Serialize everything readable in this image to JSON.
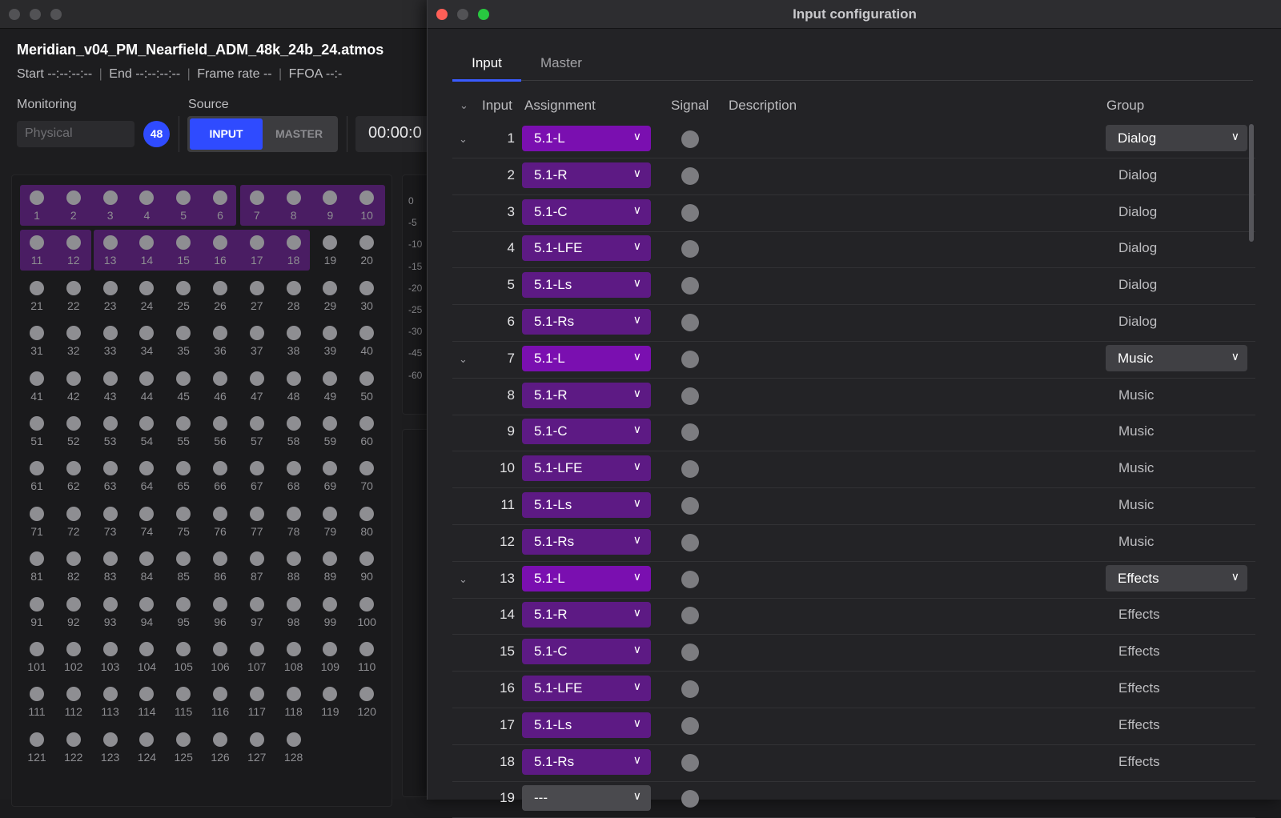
{
  "background_window": {
    "session_name": "Meridian_v04_PM_Nearfield_ADM_48k_24b_24.atmos",
    "start_label": "Start",
    "start_value": "--:--:--:--",
    "end_label": "End",
    "end_value": "--:--:--:--",
    "frame_rate_label": "Frame rate",
    "frame_rate_value": "--",
    "ffoa_label": "FFOA",
    "ffoa_value": "--:-",
    "monitoring_label": "Monitoring",
    "monitoring_value": "Physical",
    "channel_count": "48",
    "source_label": "Source",
    "source_input": "INPUT",
    "source_master": "MASTER",
    "timecode": "00:00:0",
    "meter_scale": [
      "0",
      "-5",
      "-10",
      "-15",
      "-20",
      "-25",
      "-30",
      "-45",
      "-60"
    ],
    "total_channels": 128
  },
  "window": {
    "title": "Input configuration"
  },
  "tabs": [
    {
      "label": "Input",
      "active": true
    },
    {
      "label": "Master",
      "active": false
    }
  ],
  "table": {
    "headers": {
      "input": "Input",
      "assignment": "Assignment",
      "signal": "Signal",
      "description": "Description",
      "group": "Group"
    },
    "rows": [
      {
        "input": "1",
        "assignment": "5.1-L",
        "group": "Dialog",
        "first": true
      },
      {
        "input": "2",
        "assignment": "5.1-R",
        "group": "Dialog",
        "first": false
      },
      {
        "input": "3",
        "assignment": "5.1-C",
        "group": "Dialog",
        "first": false
      },
      {
        "input": "4",
        "assignment": "5.1-LFE",
        "group": "Dialog",
        "first": false
      },
      {
        "input": "5",
        "assignment": "5.1-Ls",
        "group": "Dialog",
        "first": false
      },
      {
        "input": "6",
        "assignment": "5.1-Rs",
        "group": "Dialog",
        "first": false
      },
      {
        "input": "7",
        "assignment": "5.1-L",
        "group": "Music",
        "first": true
      },
      {
        "input": "8",
        "assignment": "5.1-R",
        "group": "Music",
        "first": false
      },
      {
        "input": "9",
        "assignment": "5.1-C",
        "group": "Music",
        "first": false
      },
      {
        "input": "10",
        "assignment": "5.1-LFE",
        "group": "Music",
        "first": false
      },
      {
        "input": "11",
        "assignment": "5.1-Ls",
        "group": "Music",
        "first": false
      },
      {
        "input": "12",
        "assignment": "5.1-Rs",
        "group": "Music",
        "first": false
      },
      {
        "input": "13",
        "assignment": "5.1-L",
        "group": "Effects",
        "first": true
      },
      {
        "input": "14",
        "assignment": "5.1-R",
        "group": "Effects",
        "first": false
      },
      {
        "input": "15",
        "assignment": "5.1-C",
        "group": "Effects",
        "first": false
      },
      {
        "input": "16",
        "assignment": "5.1-LFE",
        "group": "Effects",
        "first": false
      },
      {
        "input": "17",
        "assignment": "5.1-Ls",
        "group": "Effects",
        "first": false
      },
      {
        "input": "18",
        "assignment": "5.1-Rs",
        "group": "Effects",
        "first": false
      },
      {
        "input": "19",
        "assignment": "---",
        "group": "",
        "first": false
      }
    ]
  },
  "colors": {
    "accent_blue": "#2f4bff",
    "assignment_purple": "#5d1a84",
    "assignment_purple_bright": "#7a0fb0",
    "close_red": "#fe5f57",
    "minimize_yellow": "#febc2e",
    "zoom_green": "#28c840"
  }
}
